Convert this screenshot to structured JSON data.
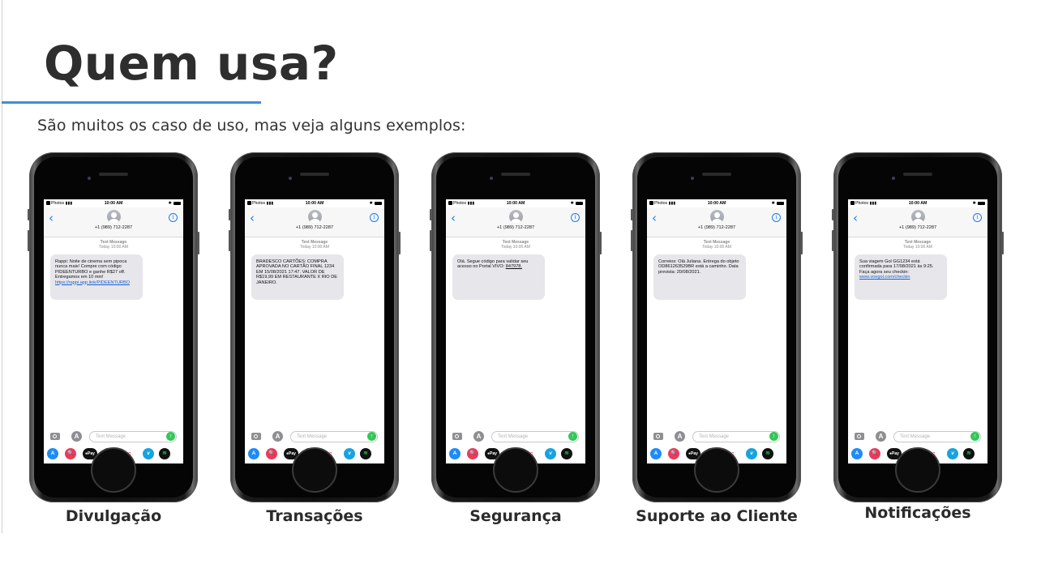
{
  "slide": {
    "title": "Quem usa?",
    "subtitle": "São muitos os caso de uso, mas veja alguns exemplos:"
  },
  "phone_ui": {
    "status_left": "Photos",
    "time": "10:00 AM",
    "back_icon": "‹",
    "info_icon": "i",
    "number": "+1 (989) 712-2287",
    "meta_type": "Text Message",
    "meta_when": "Today 10:00 AM",
    "compose_placeholder": "Text Message",
    "send_icon": "↑",
    "apps_icon": "A",
    "app_labels": {
      "store": "A",
      "search": "🔍",
      "pay": "●Pay",
      "heart": "♥",
      "music": "♫",
      "vimeo": "v",
      "spotify": "≋"
    }
  },
  "phones": [
    {
      "caption": "Divulgação",
      "message": "Rappi: Noite de cinema sem pipoca nunca mais! Compre com código PIDEENTURBO e ganhe R$27 off. Entregamos em 10 min!",
      "link": "https://rappi.app.link/PIDEENTURBO"
    },
    {
      "caption": "Transações",
      "message": "BRADESCO CARTÕES: COMPRA APROVADA NO CARTÃO FINAL 1234 EM 15/08/2021 17:47. VALOR DE R$19,99 EM RESTAURANTE X RIO DE JANEIRO.",
      "link": ""
    },
    {
      "caption": "Segurança",
      "message": "Olá. Segue código para validar seu acesso no Portal VIVO:",
      "code": "847978."
    },
    {
      "caption": "Suporte ao Cliente",
      "message": "Correios: Olá Juliana. Entrega do objeto OD861263529BR está a caminho. Data prevista: 20/08/2021.",
      "link": ""
    },
    {
      "caption": "Notificações",
      "message": "Sua viagem Gol GG1234 está confirmada para 17/08/2021 às 9:25. Faça agora seu checkin:",
      "link": "www.voegol.com/checkin"
    }
  ]
}
